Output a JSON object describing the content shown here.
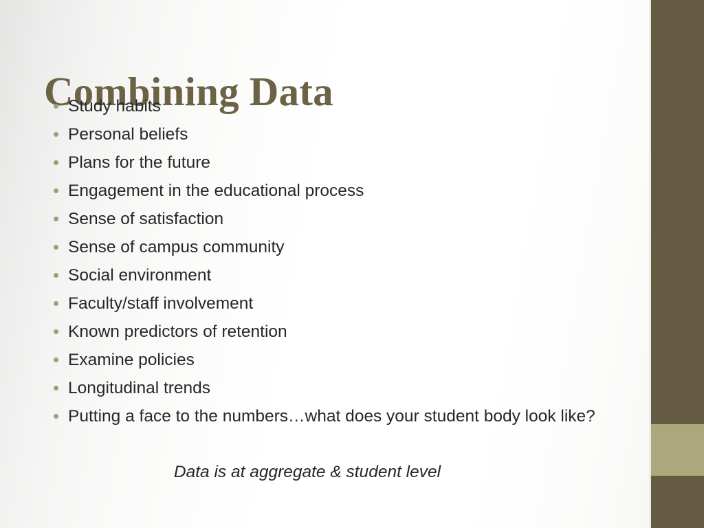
{
  "slide": {
    "title": "Combining Data",
    "bullets": [
      {
        "text": "Study habits"
      },
      {
        "text": "Personal beliefs"
      },
      {
        "text": "Plans for the future"
      },
      {
        "text": "Engagement in the educational process"
      },
      {
        "text": "Sense of satisfaction"
      },
      {
        "text": "Sense of campus community"
      },
      {
        "text": "Social environment"
      },
      {
        "text": "Faculty/staff involvement"
      },
      {
        "text": "Known predictors of retention"
      },
      {
        "text": "Examine policies"
      },
      {
        "text": "Longitudinal trends"
      },
      {
        "text": "Putting a face to the numbers…what does your student body look like?"
      }
    ],
    "closing_note": "Data is at aggregate & student level"
  },
  "theme": {
    "title_color": "#6c6347",
    "body_text_color": "#272727",
    "bullet_dot_color": "#9aa179",
    "sidebar_dark_color": "#655b43",
    "sidebar_accent_color": "#aaa87c",
    "background_color": "#ffffff"
  }
}
